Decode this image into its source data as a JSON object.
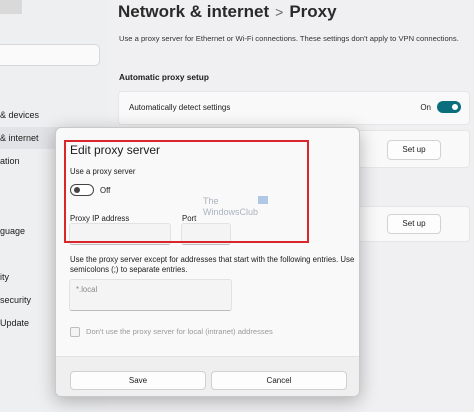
{
  "sidebar": {
    "items": [
      {
        "label": "& devices"
      },
      {
        "label": "& internet"
      },
      {
        "label": "ation"
      },
      {
        "label": "guage"
      },
      {
        "label": "ity"
      },
      {
        "label": "security"
      },
      {
        "label": "Update"
      }
    ]
  },
  "header": {
    "breadcrumb_parent": "Network & internet",
    "breadcrumb_separator": ">",
    "breadcrumb_current": "Proxy"
  },
  "page": {
    "description": "Use a proxy server for Ethernet or Wi-Fi connections. These settings don't apply to VPN connections.",
    "section_title": "Automatic proxy setup",
    "auto_detect_label": "Automatically detect settings",
    "auto_detect_state": "On",
    "setup_button_1": "Set up",
    "setup_button_2": "Set up"
  },
  "dialog": {
    "title": "Edit proxy server",
    "use_proxy_label": "Use a proxy server",
    "use_proxy_state": "Off",
    "proxy_ip_label": "Proxy IP address",
    "port_label": "Port",
    "proxy_ip_value": "",
    "port_value": "",
    "exceptions_text": "Use the proxy server except for addresses that start with the following entries. Use semicolons (;) to separate entries.",
    "exceptions_placeholder": "*.local",
    "local_checkbox_label": "Don't use the proxy server for local (intranet) addresses",
    "save_label": "Save",
    "cancel_label": "Cancel"
  },
  "watermark": {
    "line1": "The",
    "line2": "WindowsClub"
  },
  "colors": {
    "accent": "#0a6e7c",
    "highlight_box": "#d8262b"
  }
}
